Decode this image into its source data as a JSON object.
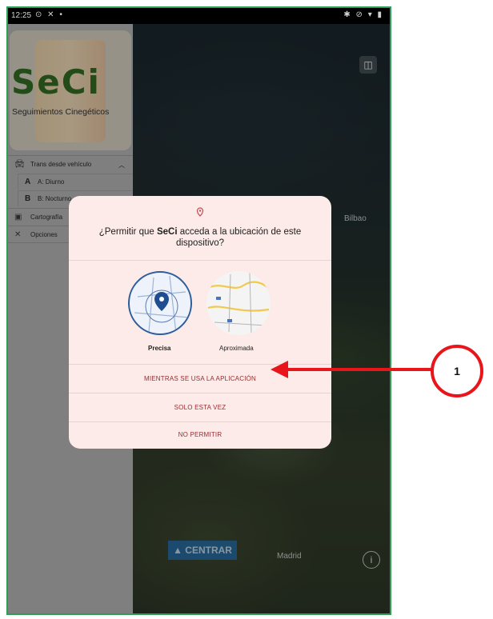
{
  "statusbar": {
    "time": "12:25",
    "icons_left": "⊙ ✕ •",
    "icons_right": "✱ ⊘ ▾ ▮"
  },
  "drawer": {
    "logo_text": "SeCi",
    "logo_subtitle": "Seguimientos Cinegéticos",
    "items": [
      {
        "icon": "car-icon",
        "label": "Trans desde vehículo",
        "chevron": "︿"
      },
      {
        "letter": "A",
        "label": "A: Diurno"
      },
      {
        "letter": "B",
        "label": "B: Nocturno"
      },
      {
        "icon": "map-layer-icon",
        "label": "Cartografía"
      },
      {
        "icon": "tools-icon",
        "label": "Opciones"
      }
    ]
  },
  "map": {
    "labels": [
      "Bilbao",
      "Madrid"
    ],
    "center_button": "▲ CENTRAR"
  },
  "dialog": {
    "title_prefix": "¿Permitir que ",
    "app_name": "SeCi",
    "title_suffix": " acceda a la ubicación de este dispositivo?",
    "option_precise": "Precisa",
    "option_approx": "Aproximada",
    "btn_while_using": "MIENTRAS SE USA LA APLICACIÓN",
    "btn_only_once": "SOLO ESTA VEZ",
    "btn_deny": "NO PERMITIR"
  },
  "annotation": {
    "callout_number": "1",
    "color": "#e8151b"
  }
}
